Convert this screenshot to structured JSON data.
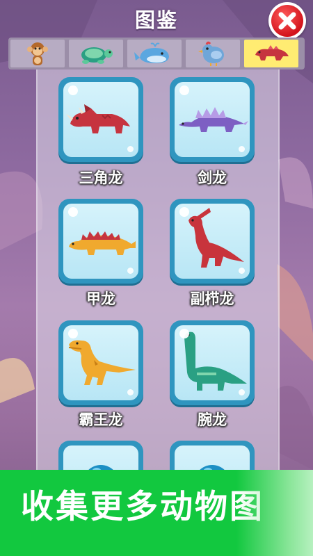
{
  "header": {
    "title": "图鉴"
  },
  "tabs": [
    {
      "name": "monkey",
      "icon": "monkey-icon",
      "active": false
    },
    {
      "name": "turtle",
      "icon": "turtle-icon",
      "active": false
    },
    {
      "name": "whale",
      "icon": "whale-icon",
      "active": false
    },
    {
      "name": "bird",
      "icon": "bird-icon",
      "active": false
    },
    {
      "name": "dinosaur",
      "icon": "dinosaur-icon",
      "active": true
    }
  ],
  "collection": {
    "items": [
      {
        "label": "三角龙",
        "icon": "triceratops-icon",
        "color": "#c6343f"
      },
      {
        "label": "剑龙",
        "icon": "stegosaurus-icon",
        "color": "#7d5fc3"
      },
      {
        "label": "甲龙",
        "icon": "ankylosaurus-icon",
        "color": "#f0a92e"
      },
      {
        "label": "副栉龙",
        "icon": "parasaurolophus-icon",
        "color": "#c8343c"
      },
      {
        "label": "霸王龙",
        "icon": "t-rex-icon",
        "color": "#f0a92e"
      },
      {
        "label": "腕龙",
        "icon": "brachiosaurus-icon",
        "color": "#2aa083"
      }
    ]
  },
  "promo": {
    "text": "收集更多动物图"
  },
  "colors": {
    "banner": "#12c83f",
    "card_frame": "#2f95bf",
    "active_tab": "#ffec72",
    "close": "#d3141c"
  }
}
